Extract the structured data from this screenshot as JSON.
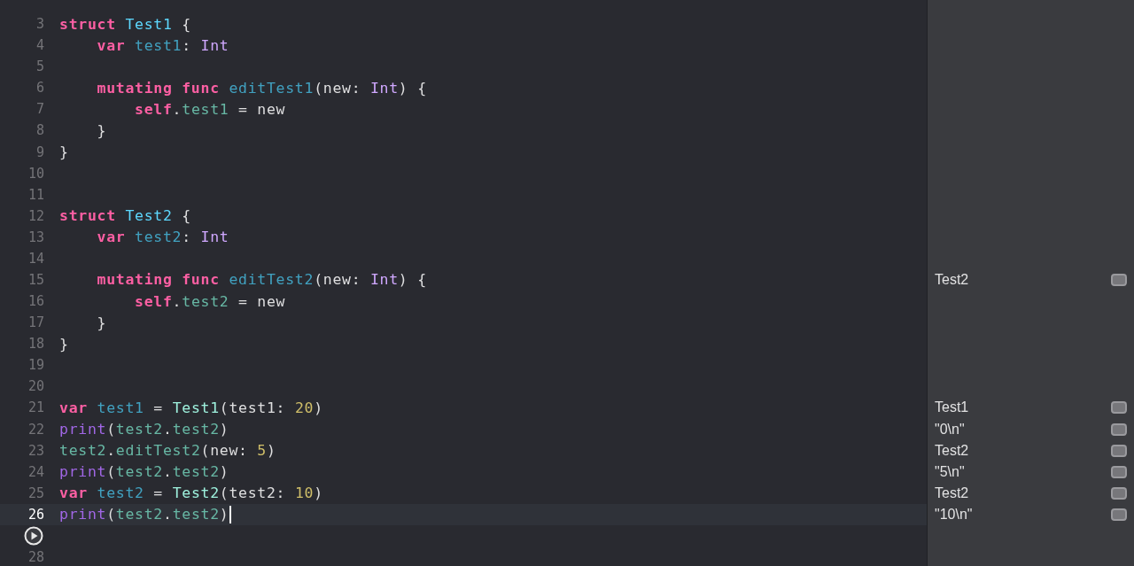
{
  "editor": {
    "lines": [
      {
        "number": "3",
        "current": false,
        "tokens": [
          {
            "t": "struct ",
            "kind": "keyword"
          },
          {
            "t": "Test1",
            "kind": "typeDecl"
          },
          {
            "t": " {",
            "kind": "plain"
          }
        ]
      },
      {
        "number": "4",
        "current": false,
        "tokens": [
          {
            "t": "    var ",
            "kind": "keyword"
          },
          {
            "t": "test1",
            "kind": "decl"
          },
          {
            "t": ": ",
            "kind": "plain"
          },
          {
            "t": "Int",
            "kind": "builtinType"
          }
        ]
      },
      {
        "number": "5",
        "current": false
      },
      {
        "number": "6",
        "current": false,
        "tokens": [
          {
            "t": "    mutating func ",
            "kind": "keyword"
          },
          {
            "t": "editTest1",
            "kind": "decl"
          },
          {
            "t": "(new: ",
            "kind": "plain"
          },
          {
            "t": "Int",
            "kind": "builtinType"
          },
          {
            "t": ") {",
            "kind": "plain"
          }
        ]
      },
      {
        "number": "7",
        "current": false,
        "tokens": [
          {
            "t": "        self",
            "kind": "keyword"
          },
          {
            "t": ".",
            "kind": "plain"
          },
          {
            "t": "test1",
            "kind": "var"
          },
          {
            "t": " = new",
            "kind": "plain"
          }
        ]
      },
      {
        "number": "8",
        "current": false,
        "tokens": [
          {
            "t": "    }",
            "kind": "plain"
          }
        ]
      },
      {
        "number": "9",
        "current": false,
        "tokens": [
          {
            "t": "}",
            "kind": "plain"
          }
        ]
      },
      {
        "number": "10",
        "current": false
      },
      {
        "number": "11",
        "current": false
      },
      {
        "number": "12",
        "current": false,
        "tokens": [
          {
            "t": "struct ",
            "kind": "keyword"
          },
          {
            "t": "Test2",
            "kind": "typeDecl"
          },
          {
            "t": " {",
            "kind": "plain"
          }
        ]
      },
      {
        "number": "13",
        "current": false,
        "tokens": [
          {
            "t": "    var ",
            "kind": "keyword"
          },
          {
            "t": "test2",
            "kind": "decl"
          },
          {
            "t": ": ",
            "kind": "plain"
          },
          {
            "t": "Int",
            "kind": "builtinType"
          }
        ]
      },
      {
        "number": "14",
        "current": false
      },
      {
        "number": "15",
        "current": false,
        "tokens": [
          {
            "t": "    mutating func ",
            "kind": "keyword"
          },
          {
            "t": "editTest2",
            "kind": "decl"
          },
          {
            "t": "(new: ",
            "kind": "plain"
          },
          {
            "t": "Int",
            "kind": "builtinType"
          },
          {
            "t": ") {",
            "kind": "plain"
          }
        ],
        "result": "Test2"
      },
      {
        "number": "16",
        "current": false,
        "tokens": [
          {
            "t": "        self",
            "kind": "keyword"
          },
          {
            "t": ".",
            "kind": "plain"
          },
          {
            "t": "test2",
            "kind": "var"
          },
          {
            "t": " = new",
            "kind": "plain"
          }
        ]
      },
      {
        "number": "17",
        "current": false,
        "tokens": [
          {
            "t": "    }",
            "kind": "plain"
          }
        ]
      },
      {
        "number": "18",
        "current": false,
        "tokens": [
          {
            "t": "}",
            "kind": "plain"
          }
        ]
      },
      {
        "number": "19",
        "current": false
      },
      {
        "number": "20",
        "current": false
      },
      {
        "number": "21",
        "current": false,
        "tokens": [
          {
            "t": "var ",
            "kind": "keyword"
          },
          {
            "t": "test1",
            "kind": "decl"
          },
          {
            "t": " = ",
            "kind": "plain"
          },
          {
            "t": "Test1",
            "kind": "type"
          },
          {
            "t": "(test1: ",
            "kind": "plain"
          },
          {
            "t": "20",
            "kind": "number"
          },
          {
            "t": ")",
            "kind": "plain"
          }
        ],
        "result": "Test1"
      },
      {
        "number": "22",
        "current": false,
        "tokens": [
          {
            "t": "print",
            "kind": "builtinFunc"
          },
          {
            "t": "(",
            "kind": "plain"
          },
          {
            "t": "test2",
            "kind": "var"
          },
          {
            "t": ".",
            "kind": "plain"
          },
          {
            "t": "test2",
            "kind": "var"
          },
          {
            "t": ")",
            "kind": "plain"
          }
        ],
        "result": "\"0\\n\""
      },
      {
        "number": "23",
        "current": false,
        "tokens": [
          {
            "t": "test2",
            "kind": "var"
          },
          {
            "t": ".",
            "kind": "plain"
          },
          {
            "t": "editTest2",
            "kind": "var"
          },
          {
            "t": "(new: ",
            "kind": "plain"
          },
          {
            "t": "5",
            "kind": "number"
          },
          {
            "t": ")",
            "kind": "plain"
          }
        ],
        "result": "Test2"
      },
      {
        "number": "24",
        "current": false,
        "tokens": [
          {
            "t": "print",
            "kind": "builtinFunc"
          },
          {
            "t": "(",
            "kind": "plain"
          },
          {
            "t": "test2",
            "kind": "var"
          },
          {
            "t": ".",
            "kind": "plain"
          },
          {
            "t": "test2",
            "kind": "var"
          },
          {
            "t": ")",
            "kind": "plain"
          }
        ],
        "result": "\"5\\n\""
      },
      {
        "number": "25",
        "current": false,
        "tokens": [
          {
            "t": "var ",
            "kind": "keyword"
          },
          {
            "t": "test2",
            "kind": "decl"
          },
          {
            "t": " = ",
            "kind": "plain"
          },
          {
            "t": "Test2",
            "kind": "type"
          },
          {
            "t": "(test2: ",
            "kind": "plain"
          },
          {
            "t": "10",
            "kind": "number"
          },
          {
            "t": ")",
            "kind": "plain"
          }
        ],
        "result": "Test2"
      },
      {
        "number": "26",
        "current": true,
        "tokens": [
          {
            "t": "print",
            "kind": "builtinFunc"
          },
          {
            "t": "(",
            "kind": "plain"
          },
          {
            "t": "test2",
            "kind": "var"
          },
          {
            "t": ".",
            "kind": "plain"
          },
          {
            "t": "test2",
            "kind": "var"
          },
          {
            "t": ")",
            "kind": "plain"
          }
        ],
        "result": "\"10\\n\""
      },
      {
        "kind": "run",
        "current": false
      },
      {
        "number": "28",
        "current": false
      }
    ]
  }
}
